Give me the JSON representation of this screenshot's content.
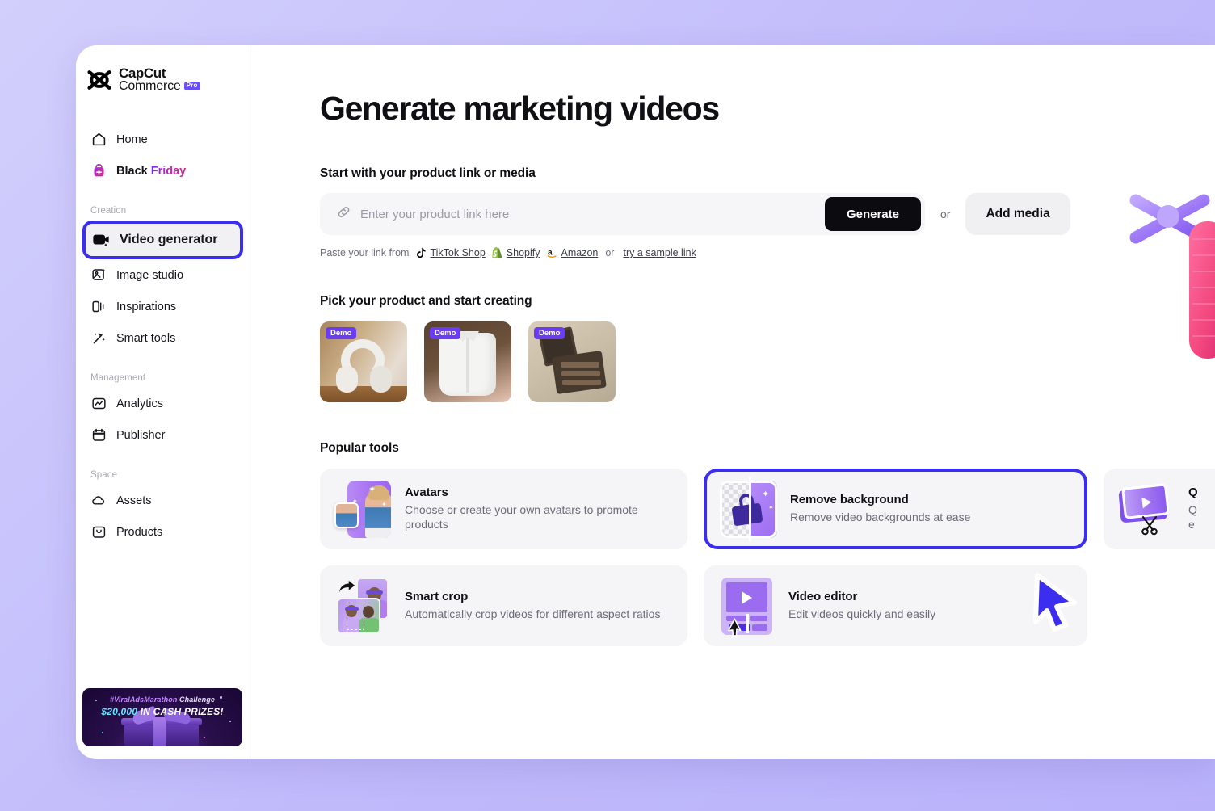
{
  "brand": {
    "logo_line1": "CapCut",
    "logo_line2": "Commerce",
    "pro_badge": "Pro",
    "accent_highlight": "#3b2eee",
    "accent_purple": "#6b3df2"
  },
  "sidebar": {
    "top_items": [
      {
        "label": "Home",
        "icon": "home-icon"
      },
      {
        "label_a": "Black",
        "label_b": "Friday",
        "icon": "shopping-bag-icon"
      }
    ],
    "groups": [
      {
        "label": "Creation",
        "items": [
          {
            "label": "Video generator",
            "icon": "video-generator-icon",
            "active": true
          },
          {
            "label": "Image studio",
            "icon": "image-studio-icon"
          },
          {
            "label": "Inspirations",
            "icon": "inspirations-icon"
          },
          {
            "label": "Smart tools",
            "icon": "magic-wand-icon"
          }
        ]
      },
      {
        "label": "Management",
        "items": [
          {
            "label": "Analytics",
            "icon": "analytics-icon"
          },
          {
            "label": "Publisher",
            "icon": "calendar-icon"
          }
        ]
      },
      {
        "label": "Space",
        "items": [
          {
            "label": "Assets",
            "icon": "cloud-icon"
          },
          {
            "label": "Products",
            "icon": "products-icon"
          }
        ]
      }
    ],
    "promo": {
      "hashtag": "#ViralAdsMarathon",
      "challenge_word": " Challenge",
      "amount": "$20,000",
      "prize_text": " IN CASH PRIZES!"
    }
  },
  "main": {
    "page_title": "Generate marketing videos",
    "start_section": {
      "title": "Start with your product link or media",
      "input_placeholder": "Enter your product link here",
      "input_value": "",
      "input_icon": "link-icon",
      "generate_label": "Generate",
      "or_label": "or",
      "add_media_label": "Add media"
    },
    "paste_row": {
      "prefix": "Paste your link from",
      "sources": [
        {
          "label": "TikTok Shop",
          "icon": "tiktok-icon"
        },
        {
          "label": "Shopify",
          "icon": "shopify-icon"
        },
        {
          "label": "Amazon",
          "icon": "amazon-icon"
        }
      ],
      "separator": "or",
      "sample_link": "try a sample link"
    },
    "products_section": {
      "title": "Pick your product and start creating",
      "badge": "Demo",
      "items": [
        {
          "name": "headphones-product",
          "badge": "Demo"
        },
        {
          "name": "white-shirt-product",
          "badge": "Demo"
        },
        {
          "name": "eyeshadow-palette-product",
          "badge": "Demo"
        }
      ]
    },
    "tools_section": {
      "title": "Popular tools",
      "tools": [
        {
          "name": "avatars",
          "title": "Avatars",
          "desc": "Choose or create your own avatars to promote products",
          "highlighted": false
        },
        {
          "name": "remove-background",
          "title": "Remove background",
          "desc": "Remove video backgrounds at ease",
          "highlighted": true
        },
        {
          "name": "quick-edit",
          "title": "Q",
          "desc": "Q",
          "desc2": "e",
          "highlighted": false
        },
        {
          "name": "smart-crop",
          "title": "Smart crop",
          "desc": "Automatically crop videos for different aspect ratios",
          "highlighted": false
        },
        {
          "name": "video-editor",
          "title": "Video editor",
          "desc": "Edit videos quickly and easily",
          "highlighted": false
        }
      ]
    }
  }
}
